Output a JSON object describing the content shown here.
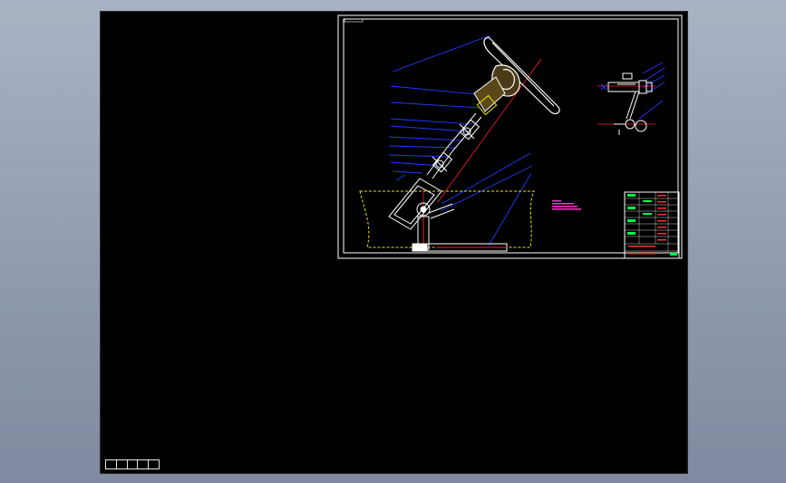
{
  "colors": {
    "background_outer": "#97a2b5",
    "viewport": "#000000",
    "frame": "#ffffff",
    "leader": "#1f3cff",
    "part_outline": "#ffffff",
    "axis": "#ff2020",
    "dash_outline": "#e6e600",
    "highlight_text": "#ff33cc",
    "table_green": "#00ff4c",
    "table_red": "#ff3030"
  },
  "icons": [
    "steering-wheel-icon",
    "universal-joint-icon",
    "gearbox-icon"
  ],
  "statusbar": {
    "cells": [
      "",
      "",
      "",
      "",
      ""
    ]
  }
}
